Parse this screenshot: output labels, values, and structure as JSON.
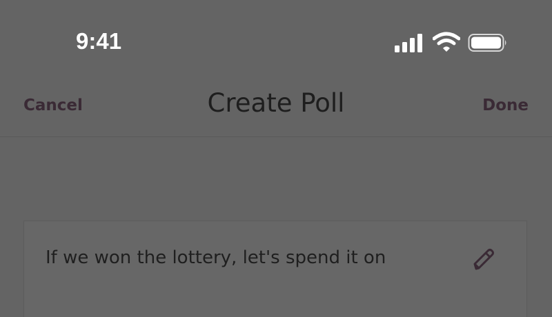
{
  "status_bar": {
    "time": "9:41",
    "icons": [
      "cellular-signal-icon",
      "wifi-icon",
      "battery-icon"
    ]
  },
  "header": {
    "cancel_label": "Cancel",
    "title": "Create Poll",
    "done_label": "Done"
  },
  "poll": {
    "question": "If we won the lottery, let's spend it on",
    "edit_icon": "pencil-icon"
  },
  "colors": {
    "background": "#646464",
    "accent": "#3a2a35",
    "status_text": "#ffffff",
    "title_text": "#1e1e1e"
  }
}
